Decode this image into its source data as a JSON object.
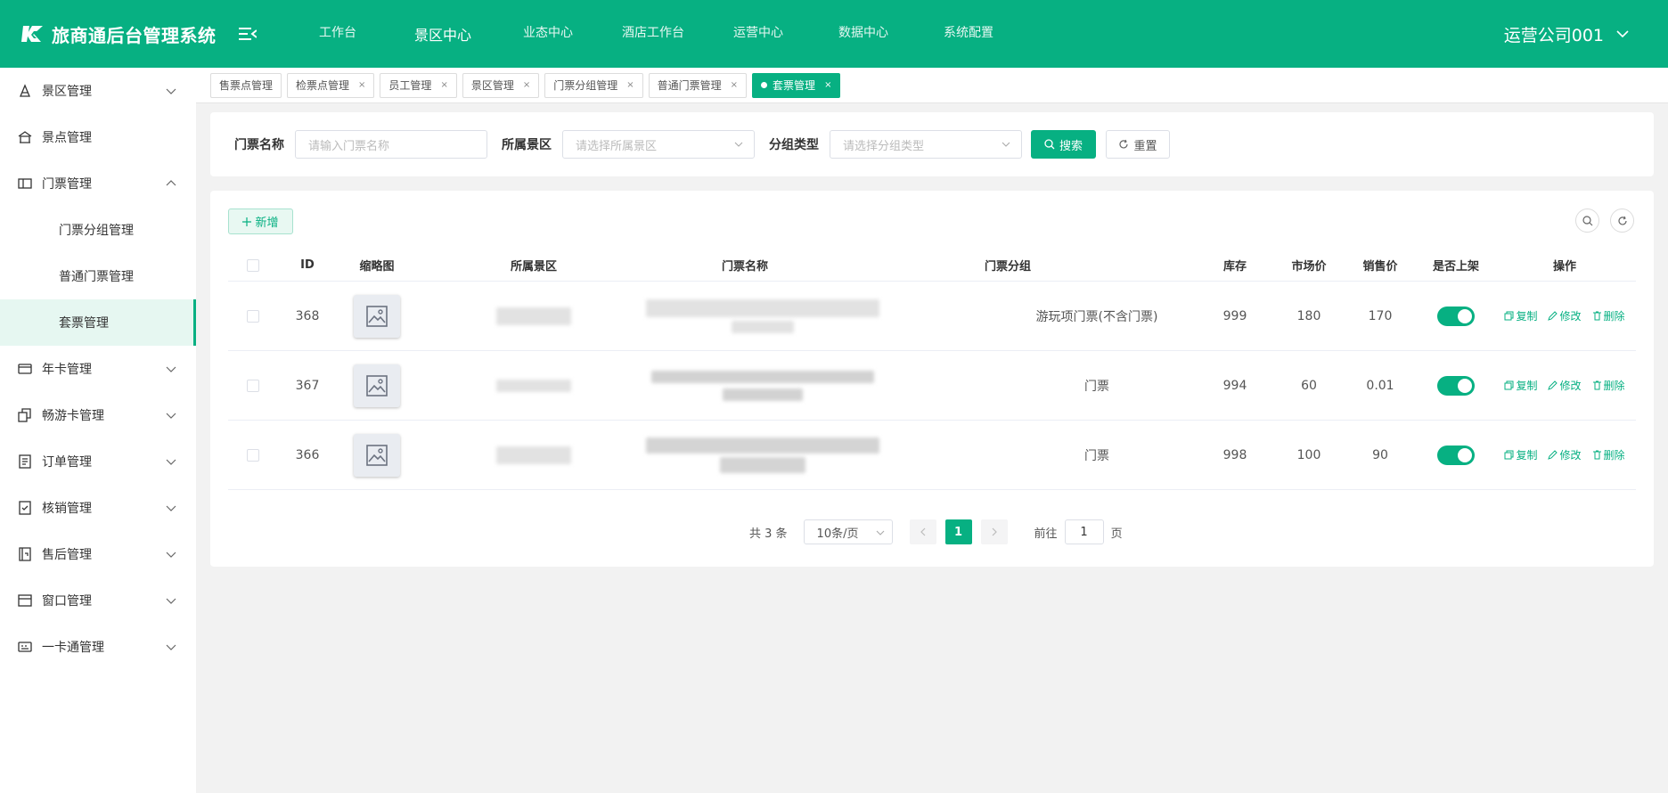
{
  "app": {
    "title": "旅商通后台管理系统"
  },
  "top_nav": [
    {
      "label": "工作台"
    },
    {
      "label": "景区中心"
    },
    {
      "label": "业态中心"
    },
    {
      "label": "酒店工作台"
    },
    {
      "label": "运营中心"
    },
    {
      "label": "数据中心"
    },
    {
      "label": "系统配置"
    }
  ],
  "top_nav_active": "景区中心",
  "user": {
    "name": "运营公司001"
  },
  "sidebar": {
    "items": [
      {
        "label": "景区管理",
        "icon": "scenic-icon",
        "expandable": true
      },
      {
        "label": "景点管理",
        "icon": "attraction-icon",
        "expandable": false
      },
      {
        "label": "门票管理",
        "icon": "ticket-icon",
        "expandable": true,
        "expanded": true
      },
      {
        "label": "门票分组管理",
        "sub": true
      },
      {
        "label": "普通门票管理",
        "sub": true
      },
      {
        "label": "套票管理",
        "sub": true,
        "active": true
      },
      {
        "label": "年卡管理",
        "icon": "card-icon",
        "expandable": true
      },
      {
        "label": "畅游卡管理",
        "icon": "cards-icon",
        "expandable": true
      },
      {
        "label": "订单管理",
        "icon": "order-icon",
        "expandable": true
      },
      {
        "label": "核销管理",
        "icon": "verify-icon",
        "expandable": true
      },
      {
        "label": "售后管理",
        "icon": "aftersale-icon",
        "expandable": true
      },
      {
        "label": "窗口管理",
        "icon": "window-icon",
        "expandable": true
      },
      {
        "label": "一卡通管理",
        "icon": "onecard-icon",
        "expandable": true
      }
    ]
  },
  "tabs": [
    {
      "label": "售票点管理",
      "closable": false
    },
    {
      "label": "检票点管理",
      "closable": true
    },
    {
      "label": "员工管理",
      "closable": true
    },
    {
      "label": "景区管理",
      "closable": true
    },
    {
      "label": "门票分组管理",
      "closable": true
    },
    {
      "label": "普通门票管理",
      "closable": true
    },
    {
      "label": "套票管理",
      "closable": true,
      "active": true
    }
  ],
  "tab_close_glyph": "×",
  "search": {
    "ticket_name_label": "门票名称",
    "ticket_name_placeholder": "请输入门票名称",
    "scenic_label": "所属景区",
    "scenic_placeholder": "请选择所属景区",
    "group_type_label": "分组类型",
    "group_type_placeholder": "请选择分组类型",
    "search_button": "搜索",
    "reset_button": "重置"
  },
  "toolbar": {
    "add_button": "新增"
  },
  "table": {
    "columns": [
      "ID",
      "缩略图",
      "所属景区",
      "门票名称",
      "门票分组",
      "库存",
      "市场价",
      "销售价",
      "是否上架",
      "操作"
    ],
    "rows": [
      {
        "id": "368",
        "group": "游玩项门票(不含门票)",
        "stock": "999",
        "market_price": "180",
        "sale_price": "170",
        "on_shelf": true
      },
      {
        "id": "367",
        "group": "门票",
        "stock": "994",
        "market_price": "60",
        "sale_price": "0.01",
        "on_shelf": true
      },
      {
        "id": "366",
        "group": "门票",
        "stock": "998",
        "market_price": "100",
        "sale_price": "90",
        "on_shelf": true
      }
    ],
    "actions": {
      "copy": "复制",
      "edit": "修改",
      "delete": "删除"
    }
  },
  "pagination": {
    "total_text": "共 3 条",
    "page_size": "10条/页",
    "current_page": "1",
    "goto_label": "前往",
    "goto_value": "1",
    "page_unit": "页"
  },
  "colors": {
    "primary": "#07b082",
    "primary_light": "#e6f7f1"
  }
}
